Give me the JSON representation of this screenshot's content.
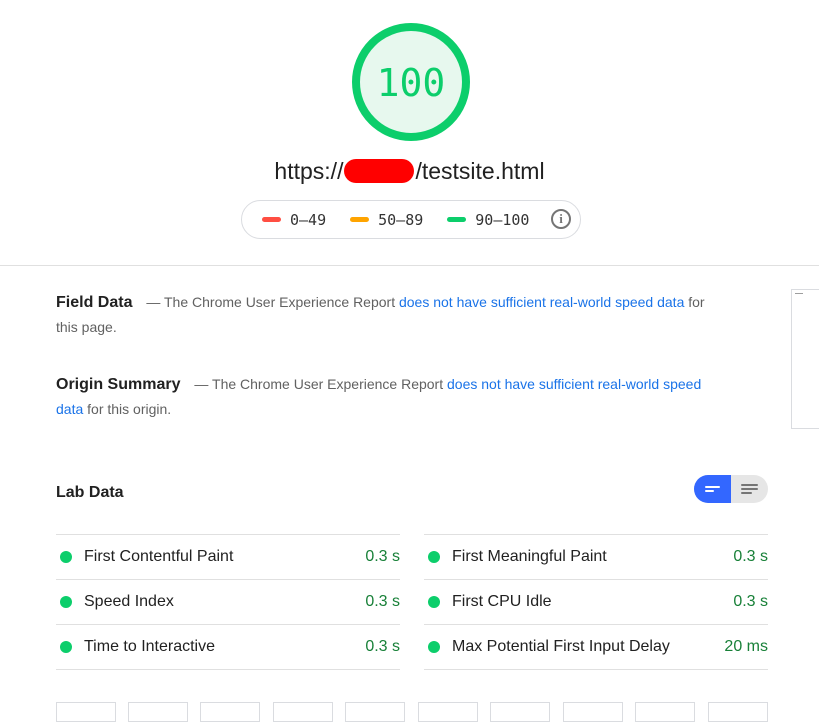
{
  "score": {
    "value": "100",
    "level": 1.0,
    "color": "#0cce6b",
    "ring_fill": "#e7f8ee"
  },
  "page_url": {
    "prefix": "https://",
    "suffix": "/testsite.html",
    "redaction_color": "#ff0000"
  },
  "legend": {
    "items": [
      {
        "label": "0–49",
        "color": "#ff4e42"
      },
      {
        "label": "50–89",
        "color": "#ffa400"
      },
      {
        "label": "90–100",
        "color": "#0cce6b"
      }
    ],
    "info_icon": "info-icon"
  },
  "field_data": {
    "title": "Field Data",
    "desc_prefix": "— The Chrome User Experience Report",
    "link_text": "does not have sufficient real-world speed data",
    "desc_suffix": "for this page."
  },
  "origin_summary": {
    "title": "Origin Summary",
    "desc_prefix": "— The Chrome User Experience Report",
    "link_text": "does not have sufficient real-world speed data",
    "desc_suffix": "for this origin."
  },
  "lab_data": {
    "title": "Lab Data",
    "toggle": {
      "active": "compact-view",
      "options": [
        "compact-view-icon",
        "list-view-icon"
      ],
      "active_color": "#3367ff"
    },
    "metrics_left": [
      {
        "label": "First Contentful Paint",
        "value": "0.3 s"
      },
      {
        "label": "Speed Index",
        "value": "0.3 s"
      },
      {
        "label": "Time to Interactive",
        "value": "0.3 s"
      }
    ],
    "metrics_right": [
      {
        "label": "First Meaningful Paint",
        "value": "0.3 s"
      },
      {
        "label": "First CPU Idle",
        "value": "0.3 s"
      },
      {
        "label": "Max Potential First Input Delay",
        "value": "20 ms"
      }
    ],
    "status_color": "#0cce6b",
    "value_color": "#188038"
  },
  "colors": {
    "link": "#1a73e8",
    "divider": "#e0e0e0"
  }
}
